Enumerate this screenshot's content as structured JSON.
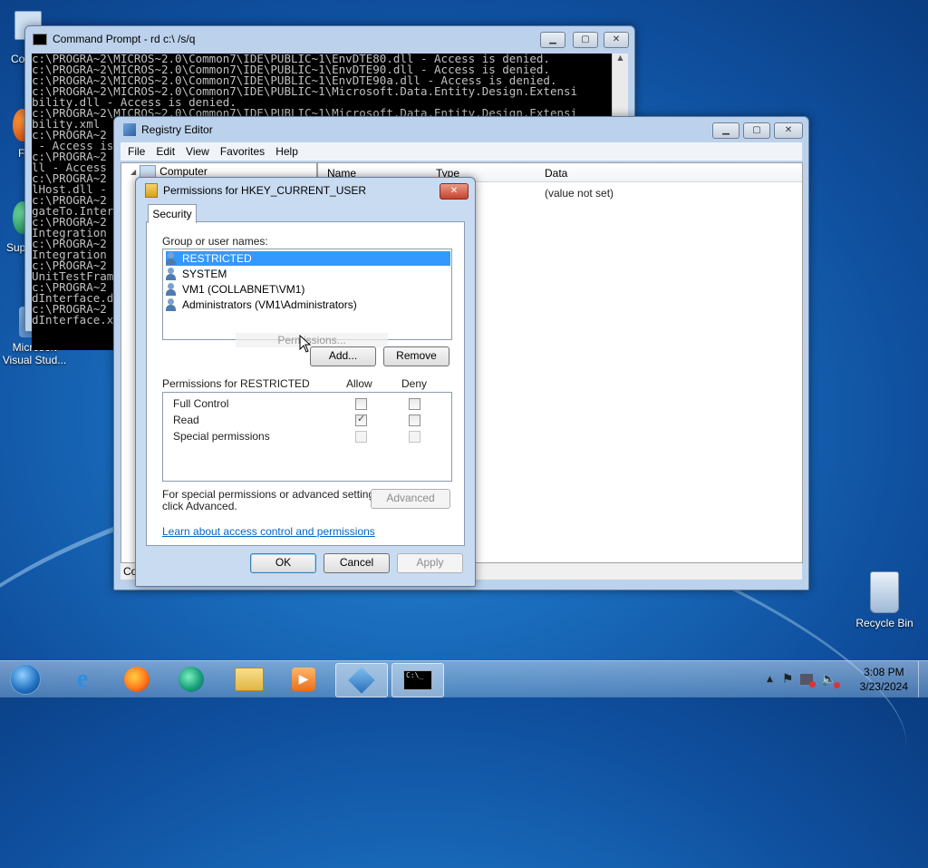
{
  "desktop": {
    "icons": [
      {
        "label_line1": "Microsoft",
        "label_line2": "Visual Stud..."
      },
      {
        "label": "Recycle Bin"
      }
    ],
    "partial_labels": [
      "Co",
      "F",
      "Sup"
    ]
  },
  "cmd_window": {
    "title": "Command Prompt - rd  c:\\ /s/q",
    "lines": [
      "c:\\PROGRA~2\\MICROS~2.0\\Common7\\IDE\\PUBLIC~1\\EnvDTE80.dll - Access is denied.",
      "c:\\PROGRA~2\\MICROS~2.0\\Common7\\IDE\\PUBLIC~1\\EnvDTE90.dll - Access is denied.",
      "c:\\PROGRA~2\\MICROS~2.0\\Common7\\IDE\\PUBLIC~1\\EnvDTE90a.dll - Access is denied.",
      "c:\\PROGRA~2\\MICROS~2.0\\Common7\\IDE\\PUBLIC~1\\Microsoft.Data.Entity.Design.Extensi",
      "bility.dll - Access is denied.",
      "c:\\PROGRA~2\\MICROS~2.0\\Common7\\IDE\\PUBLIC~1\\Microsoft.Data.Entity.Design.Extensi",
      "bility.xml",
      "c:\\PROGRA~2",
      " - Access is",
      "c:\\PROGRA~2",
      "ll - Access",
      "c:\\PROGRA~2",
      "lHost.dll -",
      "c:\\PROGRA~2",
      "gateTo.Inter",
      "c:\\PROGRA~2",
      "Integration",
      "c:\\PROGRA~2",
      "Integration",
      "c:\\PROGRA~2",
      "UnitTestFram",
      "c:\\PROGRA~2",
      "dInterface.d",
      "c:\\PROGRA~2",
      "dInterface.x"
    ]
  },
  "registry_window": {
    "title": "Registry Editor",
    "menu": [
      "File",
      "Edit",
      "View",
      "Favorites",
      "Help"
    ],
    "tree_root": "Computer",
    "columns": [
      "Name",
      "Type",
      "Data"
    ],
    "row_data": "(value not set)",
    "status": "Co"
  },
  "permissions_dialog": {
    "title": "Permissions for HKEY_CURRENT_USER",
    "tab": "Security",
    "group_label": "Group or user names:",
    "users": [
      "RESTRICTED",
      "SYSTEM",
      "VM1 (COLLABNET\\VM1)",
      "Administrators (VM1\\Administrators)"
    ],
    "selected_user_index": 0,
    "tooltip_ghost": "Permissions...",
    "add_button": "Add...",
    "remove_button": "Remove",
    "perm_header": "Permissions for RESTRICTED",
    "allow_header": "Allow",
    "deny_header": "Deny",
    "permissions": [
      {
        "name": "Full Control",
        "allow": false,
        "deny": false
      },
      {
        "name": "Read",
        "allow": true,
        "deny": false
      },
      {
        "name": "Special permissions",
        "allow": false,
        "deny": false
      }
    ],
    "advanced_text_1": "For special permissions or advanced settings,",
    "advanced_text_2": "click Advanced.",
    "advanced_button": "Advanced",
    "learn_link": "Learn about access control and permissions",
    "ok_button": "OK",
    "cancel_button": "Cancel",
    "apply_button": "Apply"
  },
  "taskbar": {
    "clock_time": "3:08 PM",
    "clock_date": "3/23/2024",
    "apps": [
      "start-orb",
      "internet-explorer",
      "firefox",
      "edge-like-browser",
      "file-explorer",
      "media-player",
      "registry-editor",
      "command-prompt"
    ]
  },
  "colors": {
    "selection": "#3399ff",
    "link": "#0066cc",
    "close_button": "#c6442c"
  }
}
